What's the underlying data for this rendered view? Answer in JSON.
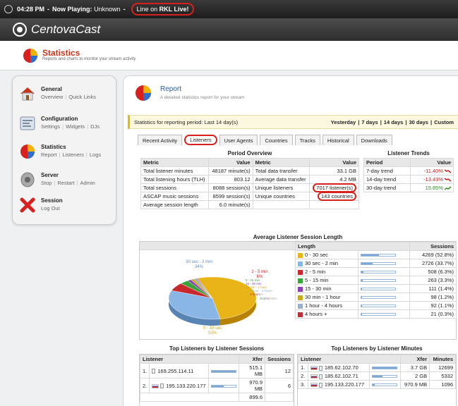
{
  "topbar": {
    "time": "04:28 PM",
    "now_label": "Now Playing:",
    "now_value": "Unknown",
    "line_label": "Line on",
    "line_value": "RKL Live!"
  },
  "brand": {
    "name": "CentovaCast"
  },
  "page": {
    "title": "Statistics",
    "subtitle": "Reports and charts to monitor your stream activity"
  },
  "sidebar": {
    "items": [
      {
        "title": "General",
        "links": [
          "Overview",
          "Quick Links"
        ],
        "icon": "house-icon"
      },
      {
        "title": "Configuration",
        "links": [
          "Settings",
          "Widgets",
          "DJs"
        ],
        "icon": "config-icon"
      },
      {
        "title": "Statistics",
        "links": [
          "Report",
          "Listeners",
          "Logs"
        ],
        "icon": "pie-chart-icon"
      },
      {
        "title": "Server",
        "links": [
          "Stop",
          "Restart",
          "Admin"
        ],
        "icon": "server-icon"
      },
      {
        "title": "Session",
        "links": [
          "Log Out"
        ],
        "icon": "logout-x-icon"
      }
    ]
  },
  "report": {
    "title": "Report",
    "subtitle": "A detailed statistics report for your stream"
  },
  "period": {
    "label": "Statistics for reporting period: Last 14 day(s)",
    "options": [
      "Yesterday",
      "7 days",
      "14 days",
      "30 days",
      "Custom"
    ]
  },
  "tabs": [
    "Recent Activity",
    "Listeners",
    "User Agents",
    "Countries",
    "Tracks",
    "Historical",
    "Downloads"
  ],
  "active_tab": "Listeners",
  "overview": {
    "title": "Period Overview",
    "headers": [
      "Metric",
      "Value",
      "Metric",
      "Value"
    ],
    "rows": [
      [
        "Total listener minutes",
        "48187 minute(s)",
        "Total data transfer",
        "33.1 GB"
      ],
      [
        "Total listening hours (TLH)",
        "803.12",
        "Average data transfer",
        "4.2 MB"
      ],
      [
        "Total sessions",
        "8088 session(s)",
        "Unique listeners",
        "7017 listener(s)"
      ],
      [
        "ASCAP music sessions",
        "8599 session(s)",
        "Unique countries",
        "143 countries"
      ],
      [
        "Average session length",
        "6.0 minute(s)",
        "",
        ""
      ]
    ]
  },
  "trends": {
    "title": "Listener Trends",
    "headers": [
      "Period",
      "Value"
    ],
    "rows": [
      {
        "period": "7-day trend",
        "value": "-11.40%",
        "dir": "down"
      },
      {
        "period": "14-day trend",
        "value": "-13.43%",
        "dir": "down"
      },
      {
        "period": "30-day trend",
        "value": "15.85%",
        "dir": "up"
      }
    ]
  },
  "avg": {
    "title": "Average Listener Session Length",
    "headers": [
      "Length",
      "Sessions"
    ],
    "pie_labels": [
      "30 sec - 2 min",
      "34%",
      "2 - 5 min",
      "6%",
      "0 - 30 sec",
      "53%"
    ],
    "pie_small_labels": [
      "5 - 15 min",
      "15 - 30 min",
      "30 min - 1 hour",
      "1 hour - 4 hours",
      "4 hours +",
      "3%",
      "1%",
      "1%",
      "0%"
    ],
    "rows": [
      {
        "label": "0 - 30 sec",
        "value": "4269 (52.8%)",
        "color": "#e8b417",
        "pct": 52.8
      },
      {
        "label": "30 sec - 2 min",
        "value": "2726 (33.7%)",
        "color": "#8ab6e6",
        "pct": 33.7
      },
      {
        "label": "2 - 5 min",
        "value": "508 (6.3%)",
        "color": "#c8282b",
        "pct": 6.3
      },
      {
        "label": "5 - 15 min",
        "value": "263 (3.3%)",
        "color": "#3aa33a",
        "pct": 3.3
      },
      {
        "label": "15 - 30 min",
        "value": "111 (1.4%)",
        "color": "#8a3fb7",
        "pct": 1.4
      },
      {
        "label": "30 min - 1 hour",
        "value": "98 (1.2%)",
        "color": "#c9a91e",
        "pct": 1.2
      },
      {
        "label": "1 hour - 4 hours",
        "value": "92 (1.1%)",
        "color": "#9bb0c9",
        "pct": 1.1
      },
      {
        "label": "4 hours +",
        "value": "21 (0.3%)",
        "color": "#b8323a",
        "pct": 0.3
      }
    ]
  },
  "top_sessions": {
    "title": "Top Listeners by Listener Sessions",
    "headers": [
      "Listener",
      "Xfer",
      "Sessions"
    ],
    "rows": [
      {
        "rank": "1.",
        "ip": "169.255.114.11",
        "flag": false,
        "xfer": "515.1 MB",
        "sessions": "12",
        "pct": 100
      },
      {
        "rank": "2.",
        "ip": "195.133.220.177",
        "flag": true,
        "xfer": "970.9 MB",
        "sessions": "6",
        "pct": 50
      }
    ],
    "partial": "899.6"
  },
  "top_minutes": {
    "title": "Top Listeners by Listener Minutes",
    "headers": [
      "Listener",
      "Xfer",
      "Minutes"
    ],
    "rows": [
      {
        "rank": "1.",
        "ip": "185.62.102.70",
        "flag": true,
        "xfer": "3.7 GB",
        "minutes": "12699",
        "pct": 100
      },
      {
        "rank": "2.",
        "ip": "185.62.102.71",
        "flag": true,
        "xfer": "2 GB",
        "minutes": "5332",
        "pct": 42
      },
      {
        "rank": "3.",
        "ip": "195.133.220.177",
        "flag": true,
        "xfer": "970.9 MB",
        "minutes": "1096",
        "pct": 9
      }
    ]
  }
}
